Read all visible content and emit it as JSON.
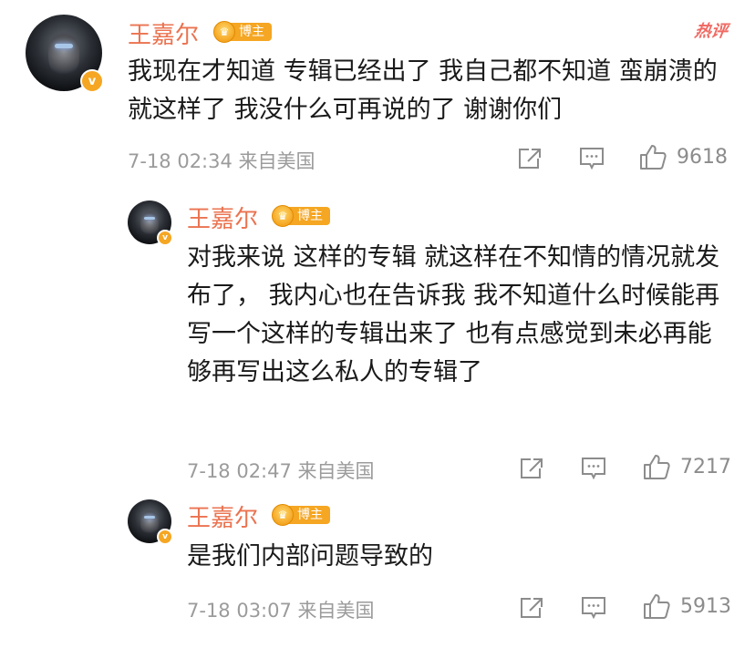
{
  "hot_label": "热评",
  "comments": [
    {
      "username": "王嘉尔",
      "badge": "博主",
      "text": "我现在才知道 专辑已经出了 我自己都不知道 蛮崩溃的 就这样了 我没什么可再说的了 谢谢你们",
      "time": "7-18 02:34 来自美国",
      "likes": "9618"
    },
    {
      "username": "王嘉尔",
      "badge": "博主",
      "text": "对我来说 这样的专辑 就这样在不知情的情况就发布了， 我内心也在告诉我 我不知道什么时候能再写一个这样的专辑出来了 也有点感觉到未必再能够再写出这么私人的专辑了",
      "time": "7-18 02:47 来自美国",
      "likes": "7217"
    },
    {
      "username": "王嘉尔",
      "badge": "博主",
      "text": "是我们内部问题导致的",
      "time": "7-18 03:07 来自美国",
      "likes": "5913"
    }
  ],
  "icons": {
    "share": "share-icon",
    "comment": "comment-icon",
    "like": "like-icon",
    "verified": "verified-badge-icon"
  },
  "colors": {
    "username": "#eb7350",
    "badge": "#f5a623",
    "meta": "#9b9b9b",
    "hot": "#f06a63"
  }
}
